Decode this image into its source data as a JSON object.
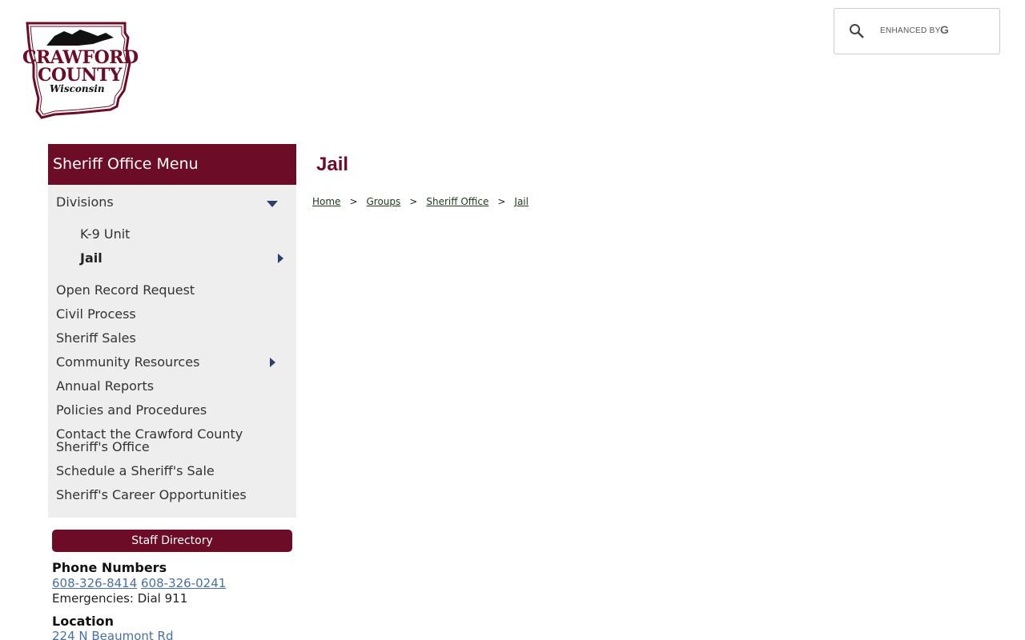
{
  "logo": {
    "line1": "CRAWFORD",
    "line2": "COUNTY",
    "line3": "Wisconsin"
  },
  "search": {
    "enhanced_label": "ENHANCED BY",
    "provider_letter": "G",
    "icon": "search-icon"
  },
  "sidebar": {
    "title": "Sheriff Office Menu",
    "items": [
      {
        "label": "Divisions",
        "expanded": true
      },
      {
        "label": "K-9 Unit"
      },
      {
        "label": "Jail",
        "active": true
      },
      {
        "label": "Open Record Request"
      },
      {
        "label": "Civil Process"
      },
      {
        "label": "Sheriff Sales"
      },
      {
        "label": "Community Resources"
      },
      {
        "label": "Annual Reports"
      },
      {
        "label": "Policies and Procedures"
      },
      {
        "label": "Contact the Crawford County Sheriff's Office"
      },
      {
        "label": "Schedule a Sheriff's Sale"
      },
      {
        "label": "Sheriff's Career Opportunities"
      }
    ]
  },
  "contact": {
    "staff_button": "Staff Directory",
    "phone_heading": "Phone Numbers",
    "phone1": "608-326-8414",
    "phone2": "608-326-0241",
    "emergency": "Emergencies: Dial 911",
    "location_heading": "Location",
    "address": "224 N Beaumont Rd"
  },
  "main": {
    "title": "Jail",
    "breadcrumb": [
      "Home",
      "Groups",
      "Sheriff Office",
      "Jail"
    ],
    "separator": ">"
  },
  "colors": {
    "brand": "#6d0c27",
    "arrow": "#2d3f70",
    "menu_bg": "#eeeeee"
  }
}
